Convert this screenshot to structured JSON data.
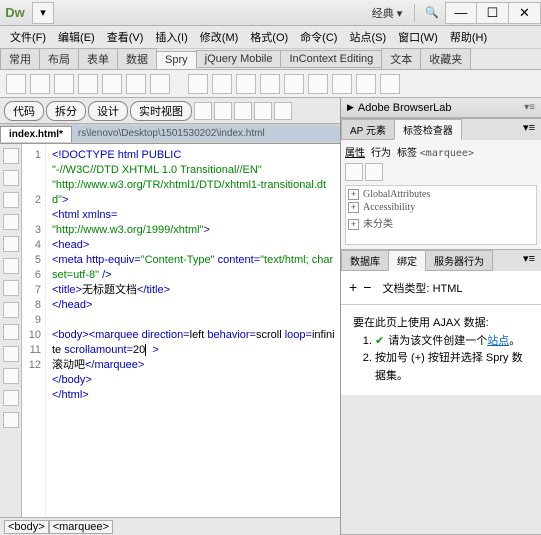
{
  "title": {
    "logo": "Dw",
    "workspace": "经典"
  },
  "menu": [
    "文件(F)",
    "编辑(E)",
    "查看(V)",
    "插入(I)",
    "修改(M)",
    "格式(O)",
    "命令(C)",
    "站点(S)",
    "窗口(W)",
    "帮助(H)"
  ],
  "insert_tabs": [
    "常用",
    "布局",
    "表单",
    "数据",
    "Spry",
    "jQuery Mobile",
    "InContext Editing",
    "文本",
    "收藏夹"
  ],
  "insert_active": "Spry",
  "doc_toolbar": {
    "code": "代码",
    "split": "拆分",
    "design": "设计",
    "live": "实时视图"
  },
  "doc_tabs": {
    "active": "index.html*",
    "path": "rs\\lenovo\\Desktop\\1501530202\\index.html"
  },
  "code_lines": [
    {
      "n": "1",
      "html": "<span class='k'>&lt;!DOCTYPE html PUBLIC</span>"
    },
    {
      "n": "",
      "html": "<span class='s'>\"-//W3C//DTD XHTML 1.0 Transitional//EN\"</span>"
    },
    {
      "n": "",
      "html": "<span class='s'>\"http://www.w3.org/TR/xhtml1/DTD/xhtml1-transitional.dtd\"</span><span class='k'>&gt;</span>"
    },
    {
      "n": "2",
      "html": "<span class='k'>&lt;html</span> <span class='t'>xmlns=</span>"
    },
    {
      "n": "",
      "html": "<span class='s'>\"http://www.w3.org/1999/xhtml\"</span><span class='k'>&gt;</span>"
    },
    {
      "n": "3",
      "html": "<span class='k'>&lt;head&gt;</span>"
    },
    {
      "n": "4",
      "html": "<span class='k'>&lt;meta</span> <span class='t'>http-equiv=</span><span class='s'>\"Content-Type\"</span> <span class='t'>content=</span><span class='s'>\"text/html; charset=utf-8\"</span> <span class='k'>/&gt;</span>"
    },
    {
      "n": "5",
      "html": "<span class='k'>&lt;title&gt;</span>无标题文档<span class='k'>&lt;/title&gt;</span>"
    },
    {
      "n": "6",
      "html": "<span class='k'>&lt;/head&gt;</span>"
    },
    {
      "n": "7",
      "html": ""
    },
    {
      "n": "8",
      "html": "<span class='k'>&lt;body&gt;&lt;marquee</span> <span class='t'>direction=</span>left <span class='t'>behavior=</span>scroll <span class='t'>loop=</span>infinite <span class='t'>scrollamount=</span>20<span style='border-left:1px solid #000'>&nbsp;</span> <span class='k'>&gt;</span>"
    },
    {
      "n": "9",
      "html": "滚动吧<span class='k'>&lt;/marquee&gt;</span>"
    },
    {
      "n": "10",
      "html": "<span class='k'>&lt;/body&gt;</span>"
    },
    {
      "n": "11",
      "html": "<span class='k'>&lt;/html&gt;</span>"
    },
    {
      "n": "12",
      "html": ""
    }
  ],
  "status_path": "<body><marquee>",
  "right_panels": {
    "browserlab": "Adobe BrowserLab",
    "ap_tab": "AP 元素",
    "taginspector_tab": "标签检查器",
    "prop": "属性",
    "behavior": "行为",
    "tag_label": "标签",
    "tag_value": "<marquee>",
    "tree": [
      "GlobalAttributes",
      "Accessibility",
      "未分类"
    ],
    "db": "数据库",
    "bind": "绑定",
    "server": "服务器行为",
    "doc_type_label": "文档类型:",
    "doc_type": "HTML",
    "ajax_title": "要在此页上使用 AJAX 数据:",
    "ajax_step1_a": "请为该文件创建一个",
    "ajax_step1_link": "站点",
    "ajax_step1_b": "。",
    "ajax_step2": "按加号 (+) 按钮并选择 Spry 数据集。"
  }
}
